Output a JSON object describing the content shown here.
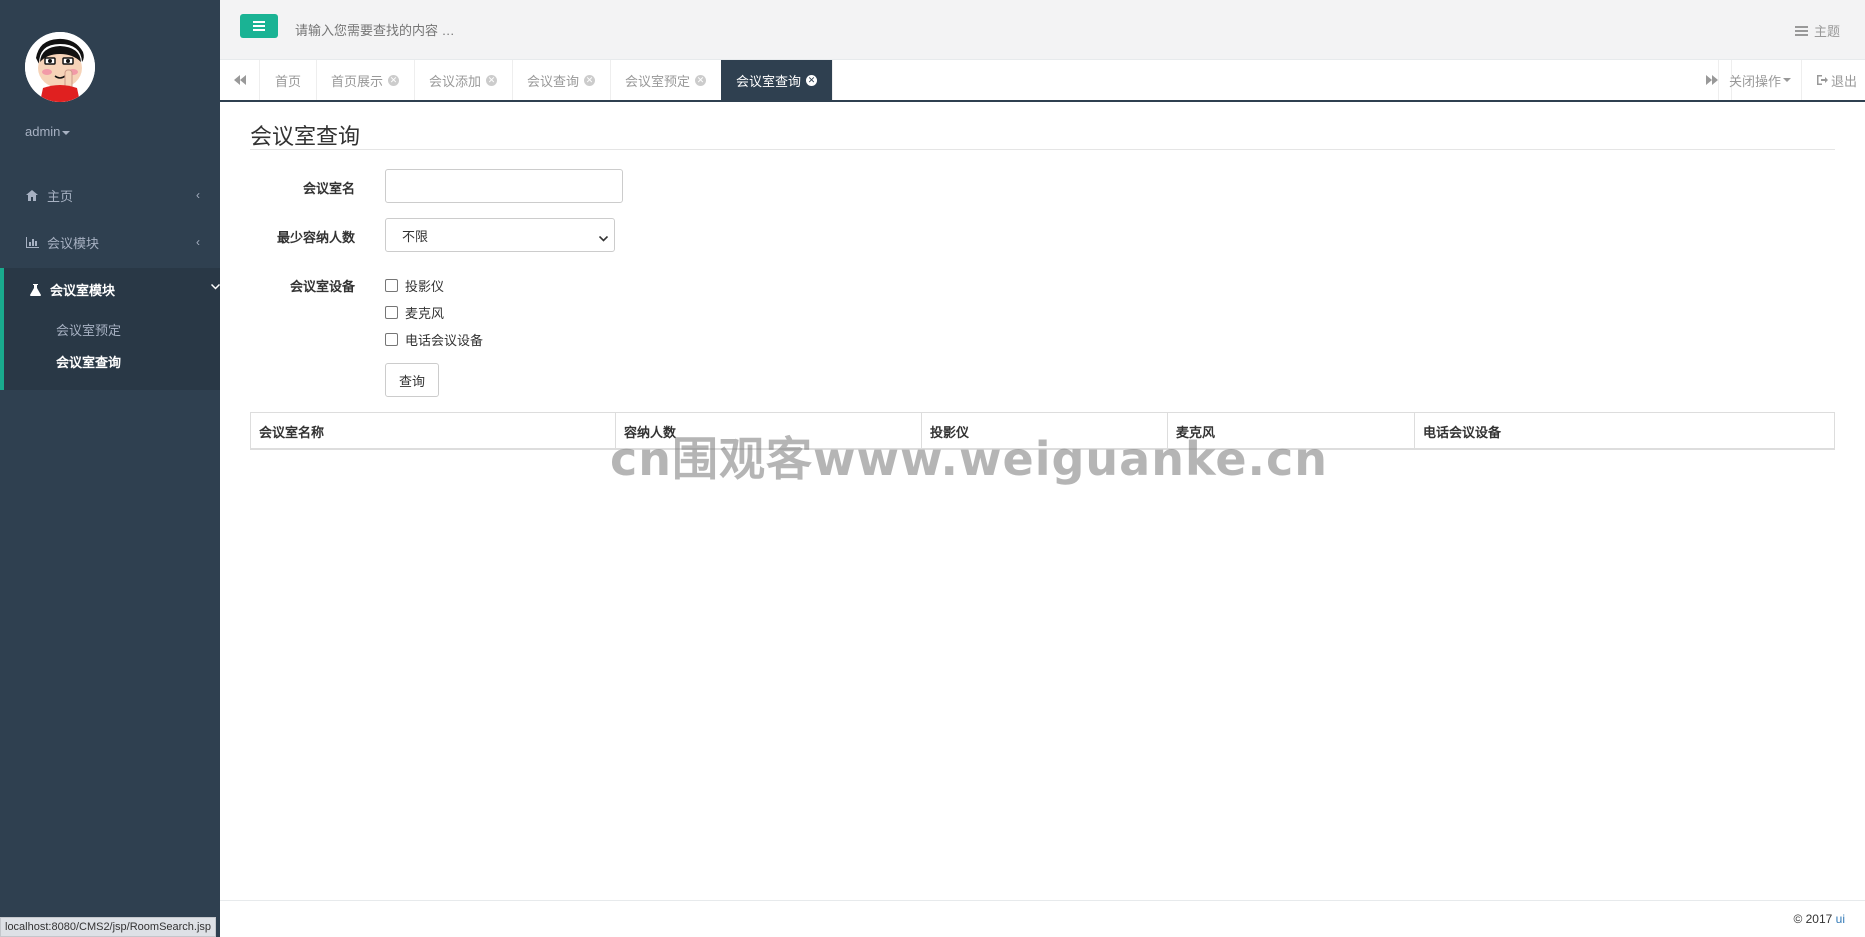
{
  "sidebar": {
    "user": "admin",
    "items": [
      {
        "label": "主页",
        "icon": "home-icon"
      },
      {
        "label": "会议模块",
        "icon": "bar-chart-icon"
      },
      {
        "label": "会议室模块",
        "icon": "flask-icon"
      }
    ],
    "submenu": [
      "会议室预定",
      "会议室查询"
    ]
  },
  "topbar": {
    "search_placeholder": "请输入您需要查找的内容 …",
    "theme_label": "主题"
  },
  "tabs": {
    "items": [
      "首页",
      "首页展示",
      "会议添加",
      "会议查询",
      "会议室预定",
      "会议室查询"
    ],
    "close_ops": "关闭操作",
    "logout": "退出"
  },
  "page": {
    "title": "会议室查询",
    "form": {
      "room_name_label": "会议室名",
      "min_capacity_label": "最少容纳人数",
      "min_capacity_value": "不限",
      "equipment_label": "会议室设备",
      "equipment_options": [
        "投影仪",
        "麦克风",
        "电话会议设备"
      ],
      "query_button": "查询"
    },
    "table": {
      "headers": [
        "会议室名称",
        "容纳人数",
        "投影仪",
        "麦克风",
        "电话会议设备"
      ]
    }
  },
  "watermark": "cn围观客www.weiguanke.cn",
  "footer": {
    "copyright": "© 2017",
    "link": "ui"
  },
  "status_url": "localhost:8080/CMS2/jsp/RoomSearch.jsp",
  "colors": {
    "sidebar_bg": "#2f4050",
    "accent": "#1ab394",
    "active_tab": "#2f4050"
  }
}
